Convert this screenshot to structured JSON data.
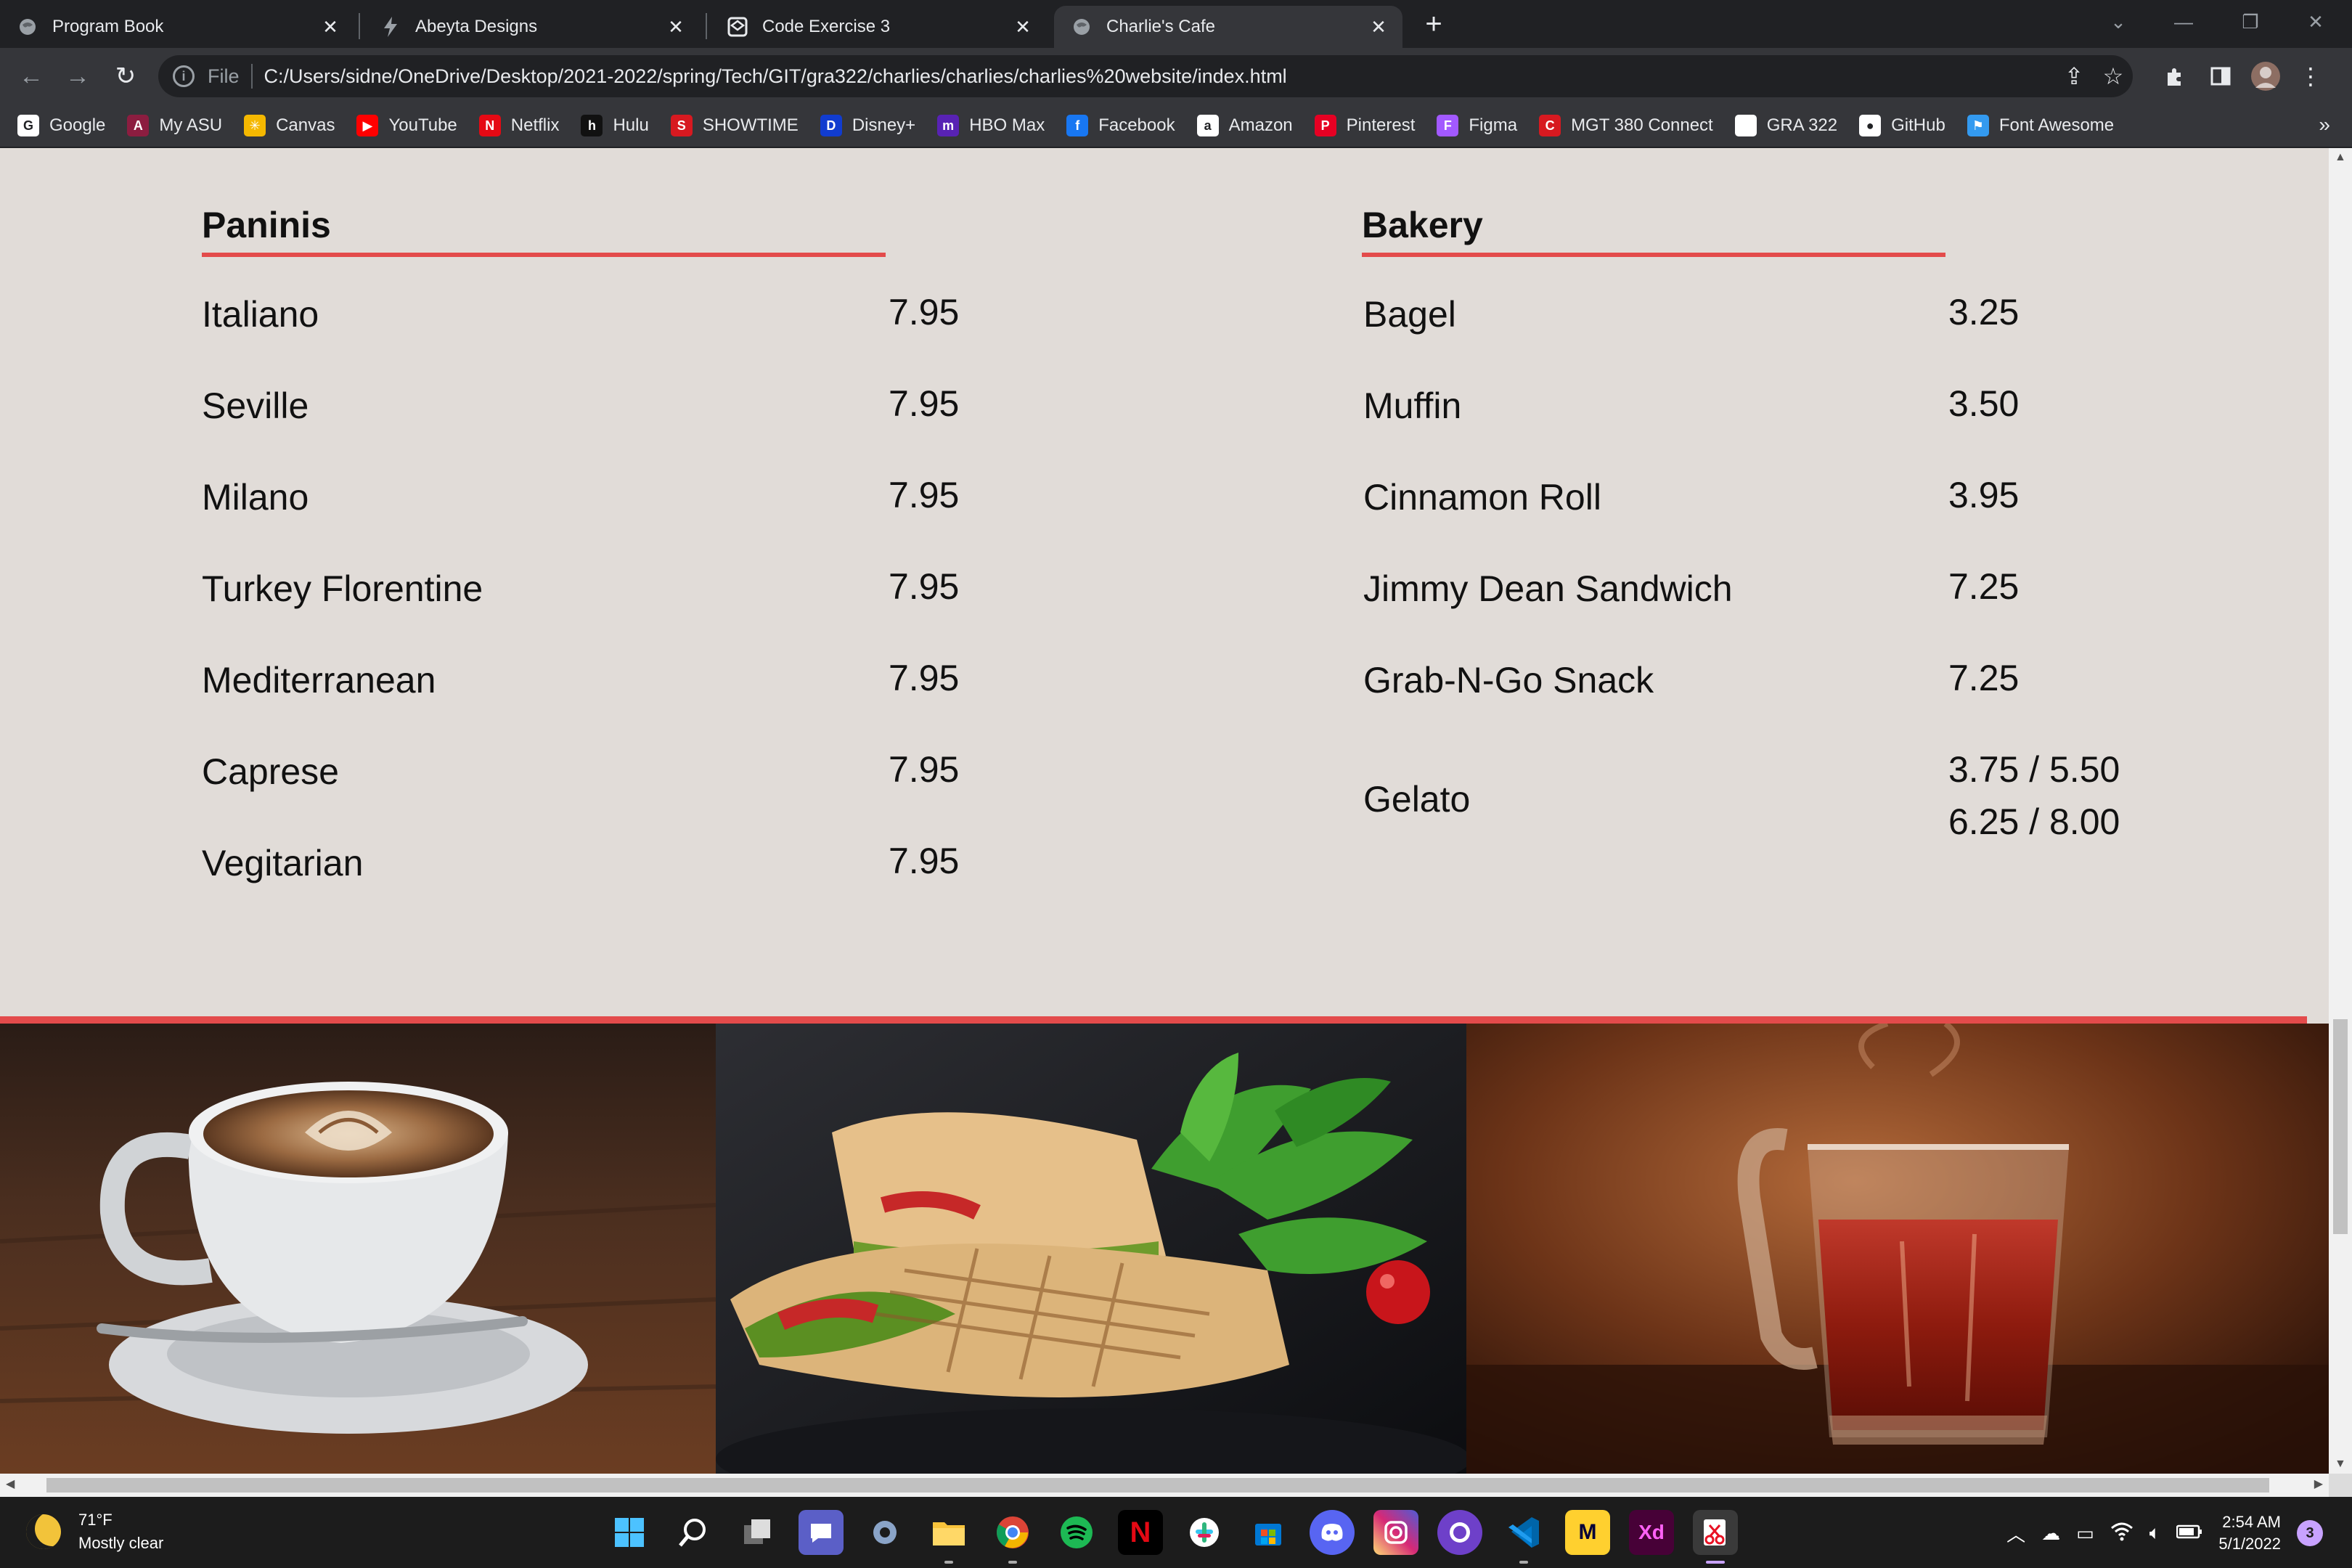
{
  "browser": {
    "tabs": [
      {
        "title": "Program Book",
        "favicon": "globe-icon",
        "active": false
      },
      {
        "title": "Abeyta Designs",
        "favicon": "bolt-icon",
        "active": false
      },
      {
        "title": "Code Exercise 3",
        "favicon": "codepen-icon",
        "active": false
      },
      {
        "title": "Charlie's Cafe",
        "favicon": "globe-icon",
        "active": true
      }
    ],
    "address": {
      "scheme_label": "File",
      "url": "C:/Users/sidne/OneDrive/Desktop/2021-2022/spring/Tech/GIT/gra322/charlies/charlies/charlies%20website/index.html"
    },
    "bookmarks": [
      {
        "label": "Google",
        "icon": "google-icon",
        "color": "#ffffff"
      },
      {
        "label": "My ASU",
        "icon": "asu-icon",
        "color": "#8c1d40"
      },
      {
        "label": "Canvas",
        "icon": "canvas-icon",
        "color": "#f5b800"
      },
      {
        "label": "YouTube",
        "icon": "youtube-icon",
        "color": "#ff0000"
      },
      {
        "label": "Netflix",
        "icon": "netflix-icon",
        "color": "#e50914"
      },
      {
        "label": "Hulu",
        "icon": "hulu-icon",
        "color": "#111111"
      },
      {
        "label": "SHOWTIME",
        "icon": "showtime-icon",
        "color": "#d71920"
      },
      {
        "label": "Disney+",
        "icon": "disney-icon",
        "color": "#113ccf"
      },
      {
        "label": "HBO Max",
        "icon": "hbomax-icon",
        "color": "#5822b4"
      },
      {
        "label": "Facebook",
        "icon": "facebook-icon",
        "color": "#1877f2"
      },
      {
        "label": "Amazon",
        "icon": "amazon-icon",
        "color": "#ffffff"
      },
      {
        "label": "Pinterest",
        "icon": "pinterest-icon",
        "color": "#e60023"
      },
      {
        "label": "Figma",
        "icon": "figma-icon",
        "color": "#a259ff"
      },
      {
        "label": "MGT 380 Connect",
        "icon": "connect-icon",
        "color": "#d71920"
      },
      {
        "label": "GRA 322",
        "icon": "page-icon",
        "color": "#ffffff"
      },
      {
        "label": "GitHub",
        "icon": "github-icon",
        "color": "#ffffff"
      },
      {
        "label": "Font Awesome",
        "icon": "flag-icon",
        "color": "#339af0"
      }
    ]
  },
  "menu": {
    "accent": "#e34b4b",
    "background": "#e1dcd8",
    "paninis": {
      "heading": "Paninis",
      "items": [
        {
          "name": "Italiano",
          "price": "7.95"
        },
        {
          "name": "Seville",
          "price": "7.95"
        },
        {
          "name": "Milano",
          "price": "7.95"
        },
        {
          "name": "Turkey Florentine",
          "price": "7.95"
        },
        {
          "name": "Mediterranean",
          "price": "7.95"
        },
        {
          "name": "Caprese",
          "price": "7.95"
        },
        {
          "name": "Vegitarian",
          "price": "7.95"
        }
      ]
    },
    "bakery": {
      "heading": "Bakery",
      "items": [
        {
          "name": "Bagel",
          "price": "3.25"
        },
        {
          "name": "Muffin",
          "price": "3.50"
        },
        {
          "name": "Cinnamon Roll",
          "price": "3.95"
        },
        {
          "name": "Jimmy Dean Sandwich",
          "price": "7.25"
        },
        {
          "name": "Grab-N-Go Snack",
          "price": "7.25"
        },
        {
          "name": "Gelato",
          "price": "3.75 / 5.50",
          "price2": "6.25 / 8.00"
        }
      ]
    }
  },
  "photos": [
    {
      "subject": "latte-art-coffee-cup"
    },
    {
      "subject": "panini-with-arugula"
    },
    {
      "subject": "glass-mug-of-tea"
    }
  ],
  "taskbar": {
    "weather_temp": "71°F",
    "weather_text": "Mostly clear",
    "time": "2:54 AM",
    "date": "5/1/2022",
    "notifications": "3",
    "apps": [
      "start-icon",
      "search-icon",
      "task-view-icon",
      "teams-chat-icon",
      "settings-icon",
      "file-explorer-icon",
      "chrome-icon",
      "spotify-icon",
      "netflix-icon",
      "slack-icon",
      "store-icon",
      "discord-icon",
      "instagram-icon",
      "github-desktop-icon",
      "vscode-icon",
      "miro-icon",
      "adobe-xd-icon",
      "snipping-tool-icon"
    ]
  }
}
